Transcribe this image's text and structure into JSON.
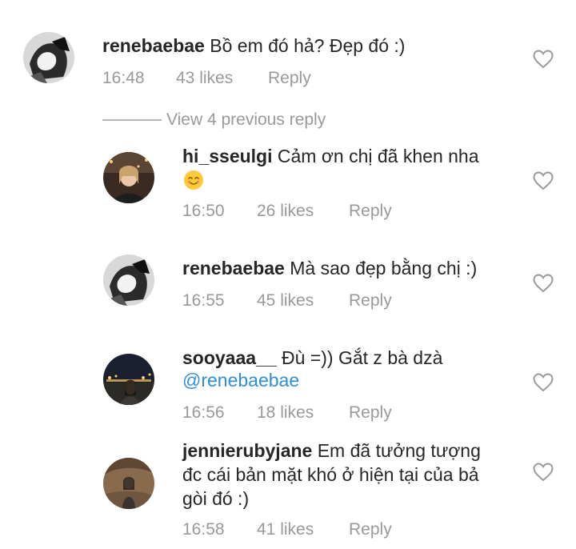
{
  "comments": [
    {
      "username": "renebaebae",
      "text": "Bồ em đó hả? Đẹp đó :)",
      "time": "16:48",
      "likes": "43 likes",
      "reply": "Reply"
    },
    {
      "username": "hi_sseulgi",
      "text": "Cảm ơn chị đã khen nha",
      "time": "16:50",
      "likes": "26 likes",
      "reply": "Reply"
    },
    {
      "username": "renebaebae",
      "text": "Mà sao đẹp bằng chị :)",
      "time": "16:55",
      "likes": "45 likes",
      "reply": "Reply"
    },
    {
      "username": "sooyaaa__",
      "text": "Đù =)) Gắt z bà dzà",
      "mention": "@renebaebae",
      "time": "16:56",
      "likes": "18 likes",
      "reply": "Reply"
    },
    {
      "username": "jennierubyjane",
      "text_line1": "Em đã tưởng tượng",
      "text_line2": "đc cái bản mặt khó ở hiện tại của bả",
      "text_line3": "gòi đó :)",
      "time": "16:58",
      "likes": "41 likes",
      "reply": "Reply"
    }
  ],
  "view_previous": "View 4 previous reply",
  "icons": {
    "like": "heart-outline-icon",
    "emoji": "smiling-face-emoji"
  },
  "colors": {
    "meta_text": "#999999",
    "mention": "#2e8fd8",
    "username": "#262626"
  }
}
